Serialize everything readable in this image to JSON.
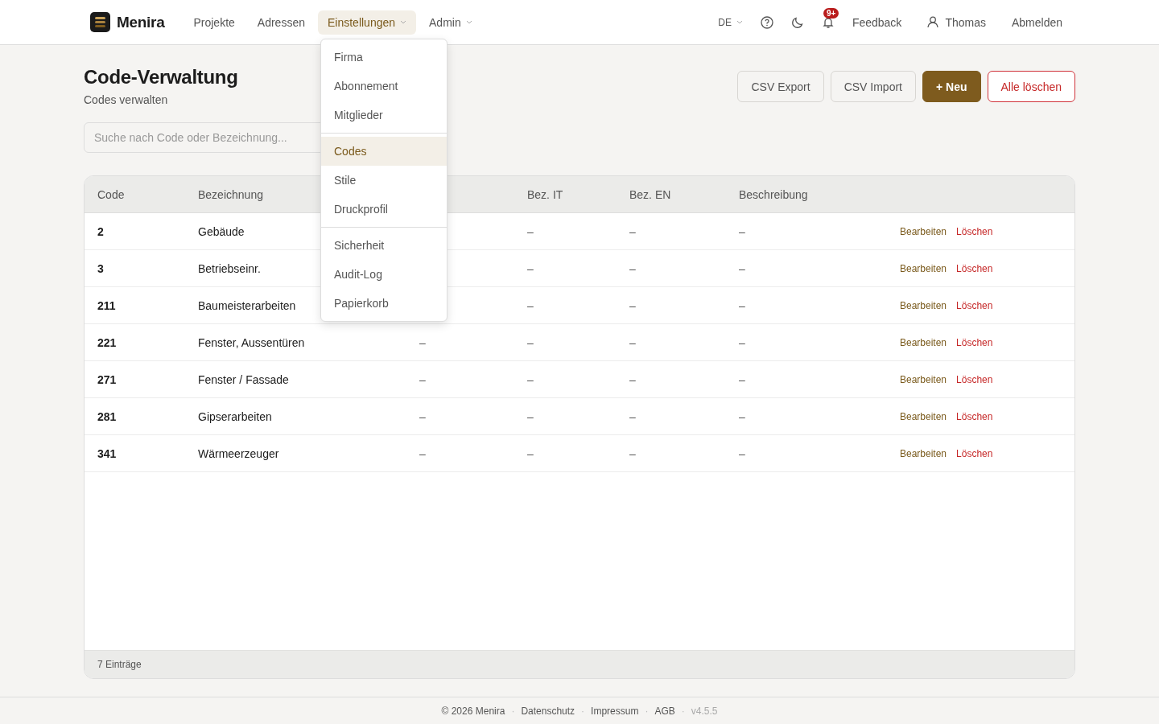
{
  "brand": {
    "name": "Menira"
  },
  "nav": [
    {
      "label": "Projekte",
      "selected": false,
      "dropdown": false
    },
    {
      "label": "Adressen",
      "selected": false,
      "dropdown": false
    },
    {
      "label": "Einstellungen",
      "selected": true,
      "dropdown": true
    },
    {
      "label": "Admin",
      "selected": false,
      "dropdown": true
    }
  ],
  "topbar": {
    "language": "DE",
    "notifications_badge": "9+",
    "feedback": "Feedback",
    "user": "Thomas",
    "logout": "Abmelden"
  },
  "menu": {
    "groups": [
      [
        {
          "label": "Firma",
          "selected": false
        },
        {
          "label": "Abonnement",
          "selected": false
        },
        {
          "label": "Mitglieder",
          "selected": false
        }
      ],
      [
        {
          "label": "Codes",
          "selected": true
        },
        {
          "label": "Stile",
          "selected": false
        },
        {
          "label": "Druckprofil",
          "selected": false
        }
      ],
      [
        {
          "label": "Sicherheit",
          "selected": false
        },
        {
          "label": "Audit-Log",
          "selected": false
        },
        {
          "label": "Papierkorb",
          "selected": false
        }
      ]
    ]
  },
  "page": {
    "title": "Code-Verwaltung",
    "subtitle": "Codes verwalten"
  },
  "actions": [
    {
      "label": "CSV Export",
      "kind": "default"
    },
    {
      "label": "CSV Import",
      "kind": "default"
    },
    {
      "label": "+ Neu",
      "kind": "primary"
    },
    {
      "label": "Alle löschen",
      "kind": "danger"
    }
  ],
  "search": {
    "placeholder": "Suche nach Code oder Bezeichnung..."
  },
  "table": {
    "columns": [
      "Code",
      "Bezeichnung",
      null,
      "Bez. IT",
      "Bez. EN",
      "Beschreibung"
    ],
    "rows": [
      {
        "code": "2",
        "name": "Gebäude",
        "bez_it": "–",
        "bez_en": "–",
        "description": "–",
        "edit": "Bearbeiten",
        "delete": "Löschen"
      },
      {
        "code": "3",
        "name": "Betriebseinr.",
        "bez_it": "–",
        "bez_en": "–",
        "description": "–",
        "edit": "Bearbeiten",
        "delete": "Löschen"
      },
      {
        "code": "211",
        "name": "Baumeisterarbeiten",
        "bez_it": "–",
        "bez_en": "–",
        "description": "–",
        "edit": "Bearbeiten",
        "delete": "Löschen"
      },
      {
        "code": "221",
        "name": "Fenster, Aussentüren",
        "column_3": "–",
        "bez_it": "–",
        "bez_en": "–",
        "description": "–",
        "edit": "Bearbeiten",
        "delete": "Löschen"
      },
      {
        "code": "271",
        "name": "Fenster / Fassade",
        "column_3": "–",
        "bez_it": "–",
        "bez_en": "–",
        "description": "–",
        "edit": "Bearbeiten",
        "delete": "Löschen"
      },
      {
        "code": "281",
        "name": "Gipserarbeiten",
        "column_3": "–",
        "bez_it": "–",
        "bez_en": "–",
        "description": "–",
        "edit": "Bearbeiten",
        "delete": "Löschen"
      },
      {
        "code": "341",
        "name": "Wärmeerzeuger",
        "column_3": "–",
        "bez_it": "–",
        "bez_en": "–",
        "description": "–",
        "edit": "Bearbeiten",
        "delete": "Löschen"
      }
    ],
    "footer": "7 Einträge"
  },
  "footer": {
    "copyright": "© 2026 Menira",
    "separator": "·",
    "links": [
      "Datenschutz",
      "Impressum",
      "AGB"
    ],
    "version": "v4.5.5"
  }
}
